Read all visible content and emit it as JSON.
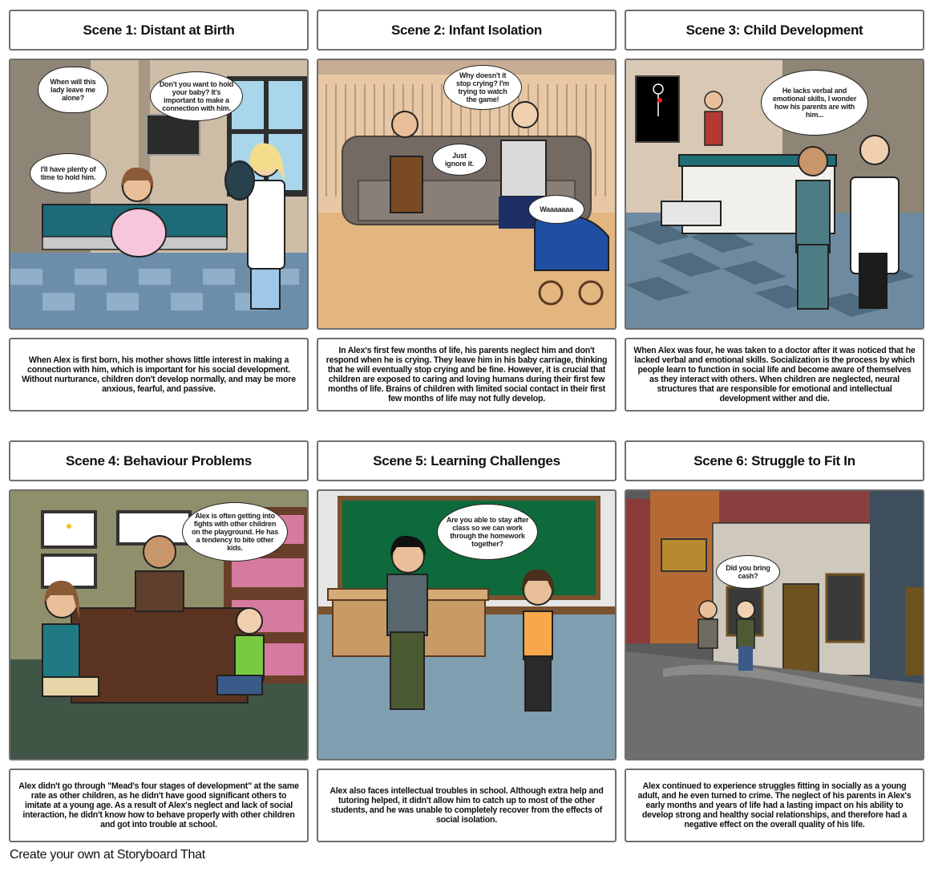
{
  "storyboard": {
    "scenes": [
      {
        "title": "Scene 1: Distant at Birth",
        "bubbles": [
          "When will this lady leave me alone?",
          "Don't you want to hold your baby? It's important to make a connection with him.",
          "I'll have plenty of time to hold him."
        ],
        "caption": "When Alex is first born, his mother shows little interest in making a connection with him, which is important for his social development. Without nurturance, children don't develop normally, and may be more anxious, fearful, and passive."
      },
      {
        "title": "Scene 2: Infant Isolation",
        "bubbles": [
          "Why doesn't it stop crying? I'm trying to watch the game!",
          "Just ignore it.",
          "Waaaaaaa"
        ],
        "caption": "In Alex's first few months of life, his parents neglect him and don't respond when he is crying. They leave him in his baby carriage, thinking that he will eventually stop crying and be fine. However, it is crucial that children are exposed to caring and loving humans during their first few months of life. Brains of children with limited social contact in their first few months of life may not fully develop."
      },
      {
        "title": "Scene 3: Child Development",
        "bubbles": [
          "He lacks verbal and emotional skills, I wonder how his parents are with him..."
        ],
        "caption": "When Alex was four, he was taken to a doctor after it was noticed that he lacked verbal and emotional skills. Socialization is the process by which people learn to function in social life and become aware of themselves as they interact with others. When children are neglected, neural structures that are responsible for emotional and intellectual development wither and die."
      },
      {
        "title": "Scene 4: Behaviour Problems",
        "bubbles": [
          "Alex is often getting into fights with other children on the playground. He has a tendency to bite other kids."
        ],
        "caption": "Alex didn't go through \"Mead's four stages of development\" at the same rate as other children, as he didn't have good significant others to imitate at a young age. As a result of Alex's neglect and lack of social interaction, he didn't know how to behave properly with other children and got into trouble at school."
      },
      {
        "title": "Scene 5: Learning Challenges",
        "bubbles": [
          "Are you able to stay after class so we can work through the homework together?"
        ],
        "caption": "Alex also faces intellectual troubles in school. Although extra help and tutoring helped, it didn't allow him to catch up to most of the other students, and he was unable to completely recover from the effects of social isolation."
      },
      {
        "title": "Scene 6: Struggle to Fit In",
        "bubbles": [
          "Did you bring cash?"
        ],
        "caption": "Alex continued to experience struggles fitting in socially as a young adult, and he even turned to crime. The neglect of his parents in Alex's early months and years of life had a lasting impact on his ability to develop strong and healthy social relationships, and therefore had a negative effect on the overall quality of his life."
      }
    ]
  },
  "footer": {
    "text": "Create your own at Storyboard That"
  }
}
